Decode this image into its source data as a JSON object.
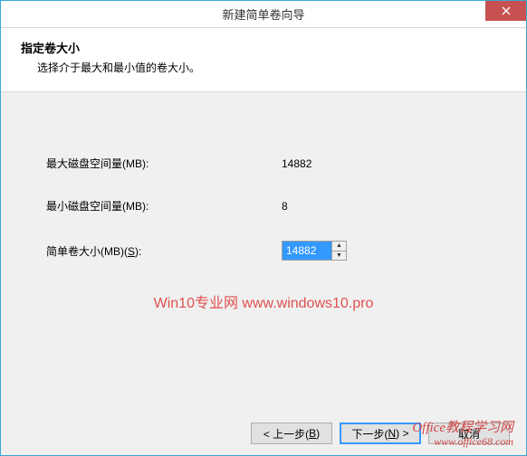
{
  "window": {
    "title": "新建简单卷向导"
  },
  "header": {
    "heading": "指定卷大小",
    "subheading": "选择介于最大和最小值的卷大小。"
  },
  "fields": {
    "max_label": "最大磁盘空间量(MB):",
    "max_value": "14882",
    "min_label": "最小磁盘空间量(MB):",
    "min_value": "8",
    "size_label_pre": "简单卷大小(MB)(",
    "size_label_key": "S",
    "size_label_post": "):",
    "size_value": "14882"
  },
  "buttons": {
    "back_pre": "< 上一步(",
    "back_key": "B",
    "back_post": ")",
    "next_pre": "下一步(",
    "next_key": "N",
    "next_post": ") >",
    "cancel": "取消"
  },
  "watermark": {
    "line1": "Win10专业网 www.windows10.pro",
    "brand1": "Office教程学习网",
    "brand2": "www.office68.com"
  }
}
